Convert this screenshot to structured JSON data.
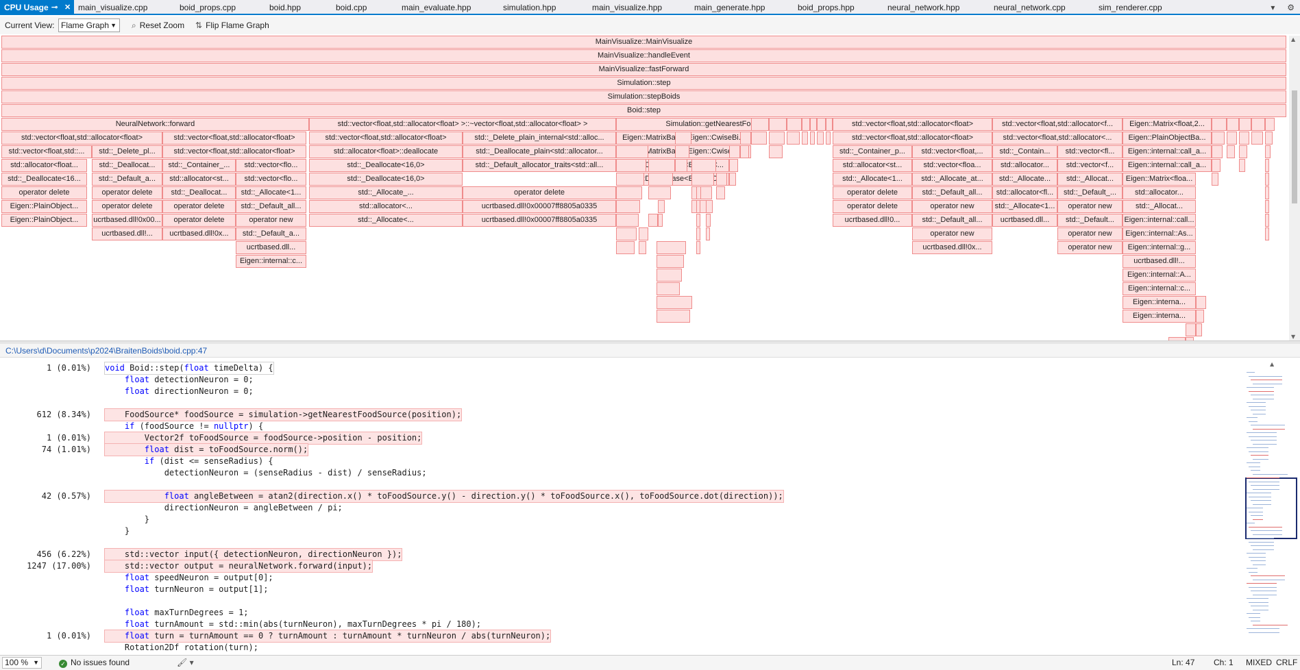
{
  "tabs": [
    {
      "label": "CPU Usage",
      "active": true
    },
    {
      "label": "main_visualize.cpp"
    },
    {
      "label": "boid_props.cpp"
    },
    {
      "label": "boid.hpp"
    },
    {
      "label": "boid.cpp"
    },
    {
      "label": "main_evaluate.hpp"
    },
    {
      "label": "simulation.hpp"
    },
    {
      "label": "main_visualize.hpp"
    },
    {
      "label": "main_generate.hpp"
    },
    {
      "label": "boid_props.hpp"
    },
    {
      "label": "neural_network.hpp"
    },
    {
      "label": "neural_network.cpp"
    },
    {
      "label": "sim_renderer.cpp"
    }
  ],
  "tab_icons": {
    "pin": "pin-icon",
    "close": "close-icon",
    "dropdown": "tab-list-dropdown-icon",
    "settings": "gear-icon"
  },
  "toolbar": {
    "view_label": "Current View:",
    "view_value": "Flame Graph",
    "reset_zoom": "Reset Zoom",
    "flip": "Flip Flame Graph"
  },
  "colors": {
    "frame_fill": "#fde0e0",
    "frame_border": "#ef8b8b",
    "accent": "#007acc",
    "hot_line": "#fde4e4"
  },
  "flame_frames": [
    {
      "label": "MainVisualize::MainVisualize"
    },
    {
      "label": "MainVisualize::handleEvent"
    },
    {
      "label": "MainVisualize::fastForward"
    },
    {
      "label": "Simulation::step"
    },
    {
      "label": "Simulation::stepBoids"
    },
    {
      "label": "Boid::step"
    },
    {
      "label": "NeuralNetwork::forward"
    },
    {
      "label": "std::vector<float,std::allocator<float> >::~vector<float,std::allocator<float> >"
    },
    {
      "label": "Simulation::getNearestFoodSource"
    },
    {
      "label": "std::vector<float,std::allocator<float>"
    },
    {
      "label": "std::vector<float,std::allocator<f..."
    },
    {
      "label": "Eigen::Matrix<float,2..."
    },
    {
      "label": "std::vector<float,std::allocator<float>"
    },
    {
      "label": "std::vector<float,std::allocator<float>"
    },
    {
      "label": "std::vector<float,std::allocator<float>"
    },
    {
      "label": "std::_Delete_plain_internal<std::alloc..."
    },
    {
      "label": "Eigen::MatrixBase<Eigen::CwiseBi..."
    },
    {
      "label": "std::vector<float,std::allocator<float>"
    },
    {
      "label": "std::vector<float,std::allocator<..."
    },
    {
      "label": "Eigen::PlainObjectBa..."
    },
    {
      "label": "std::vector<float,std::..."
    },
    {
      "label": "std::_Delete_pl..."
    },
    {
      "label": "std::vector<float,std::allocator<float>"
    },
    {
      "label": "std::allocator<float>::deallocate"
    },
    {
      "label": "std::_Deallocate_plain<std::allocator..."
    },
    {
      "label": "Eigen::MatrixBase<Eigen::CwiseBi..."
    },
    {
      "label": "std::_Container_p..."
    },
    {
      "label": "std::vector<float,..."
    },
    {
      "label": "std::_Contain..."
    },
    {
      "label": "std::vector<fl..."
    },
    {
      "label": "Eigen::internal::call_a..."
    },
    {
      "label": "std::allocator<float..."
    },
    {
      "label": "std::_Deallocat..."
    },
    {
      "label": "std::_Container_..."
    },
    {
      "label": "std::vector<flo..."
    },
    {
      "label": "std::_Deallocate<16,0>"
    },
    {
      "label": "std::_Default_allocator_traits<std::all..."
    },
    {
      "label": "Eigen::DenseBase<Eigen::C..."
    },
    {
      "label": "std::allocator<st..."
    },
    {
      "label": "std::vector<floa..."
    },
    {
      "label": "std::allocator..."
    },
    {
      "label": "std::vector<f..."
    },
    {
      "label": "Eigen::internal::call_a..."
    },
    {
      "label": "std::_Deallocate<16..."
    },
    {
      "label": "std::_Default_a..."
    },
    {
      "label": "std::allocator<st..."
    },
    {
      "label": "std::vector<flo..."
    },
    {
      "label": "operator delete"
    },
    {
      "label": "std::_Deallocate<16,0>"
    },
    {
      "label": "Eigen::DenseBase<Eigen::C..."
    },
    {
      "label": "std::_Allocate<1..."
    },
    {
      "label": "std::_Allocate_at..."
    },
    {
      "label": "std::_Allocate..."
    },
    {
      "label": "std::_Allocat..."
    },
    {
      "label": "Eigen::Matrix<floa..."
    },
    {
      "label": "operator delete"
    },
    {
      "label": "std::_Deallocat..."
    },
    {
      "label": "std::_Allocate<1..."
    },
    {
      "label": "std::_Allocate_..."
    },
    {
      "label": "operator delete"
    },
    {
      "label": "operator delete"
    },
    {
      "label": "std::_Default_all..."
    },
    {
      "label": "std::allocator<fl..."
    },
    {
      "label": "std::_Default_..."
    },
    {
      "label": "std::allocator..."
    },
    {
      "label": "Eigen::PlainObject..."
    },
    {
      "label": "operator delete"
    },
    {
      "label": "operator delete"
    },
    {
      "label": "std::_Default_all..."
    },
    {
      "label": "std::allocator<..."
    },
    {
      "label": "ucrtbased.dll!0x00007ff8805a0335"
    },
    {
      "label": "operator delete"
    },
    {
      "label": "operator new"
    },
    {
      "label": "std::_Allocate<1..."
    },
    {
      "label": "operator new"
    },
    {
      "label": "std::_Allocat..."
    },
    {
      "label": "Eigen::PlainObject..."
    },
    {
      "label": "ucrtbased.dll!0x00..."
    },
    {
      "label": "operator delete"
    },
    {
      "label": "operator new"
    },
    {
      "label": "std::_Allocate<..."
    },
    {
      "label": "ucrtbased.dll!0x00007ff8805a0335"
    },
    {
      "label": "ucrtbased.dll!0..."
    },
    {
      "label": "std::_Default_all..."
    },
    {
      "label": "ucrtbased.dll..."
    },
    {
      "label": "std::_Default..."
    },
    {
      "label": "Eigen::internal::call..."
    },
    {
      "label": "ucrtbased.dll!..."
    },
    {
      "label": "ucrtbased.dll!0x..."
    },
    {
      "label": "std::_Default_a..."
    },
    {
      "label": "operator new"
    },
    {
      "label": "operator new"
    },
    {
      "label": "Eigen::internal::As..."
    },
    {
      "label": "operator new"
    },
    {
      "label": "ucrtbased.dll!0x..."
    },
    {
      "label": "ucrtbased.dll..."
    },
    {
      "label": "Eigen::internal::g..."
    },
    {
      "label": "ucrtbased.dll!..."
    },
    {
      "label": "Eigen::internal::c..."
    },
    {
      "label": "Eigen::internal::A..."
    },
    {
      "label": "Eigen::internal::c..."
    },
    {
      "label": "Eigen::interna..."
    },
    {
      "label": "Eigen::interna..."
    }
  ],
  "path": "C:\\Users\\d\\Documents\\p2024\\BraitenBoids\\boid.cpp:47",
  "code_lines": [
    {
      "metric": "1 (0.01%)",
      "code": "void Boid::step(float timeDelta) {"
    },
    {
      "metric": "",
      "code": "    float detectionNeuron = 0;"
    },
    {
      "metric": "",
      "code": "    float directionNeuron = 0;"
    },
    {
      "metric": "",
      "code": ""
    },
    {
      "metric": "612 (8.34%)",
      "code": "    FoodSource* foodSource = simulation->getNearestFoodSource(position);"
    },
    {
      "metric": "",
      "code": "    if (foodSource != nullptr) {"
    },
    {
      "metric": "1 (0.01%)",
      "code": "        Vector2f toFoodSource = foodSource->position - position;"
    },
    {
      "metric": "74 (1.01%)",
      "code": "        float dist = toFoodSource.norm();"
    },
    {
      "metric": "",
      "code": "        if (dist <= senseRadius) {"
    },
    {
      "metric": "",
      "code": "            detectionNeuron = (senseRadius - dist) / senseRadius;"
    },
    {
      "metric": "",
      "code": ""
    },
    {
      "metric": "42 (0.57%)",
      "code": "            float angleBetween = atan2(direction.x() * toFoodSource.y() - direction.y() * toFoodSource.x(), toFoodSource.dot(direction));"
    },
    {
      "metric": "",
      "code": "            directionNeuron = angleBetween / pi;"
    },
    {
      "metric": "",
      "code": "        }"
    },
    {
      "metric": "",
      "code": "    }"
    },
    {
      "metric": "",
      "code": ""
    },
    {
      "metric": "456 (6.22%)",
      "code": "    std::vector input({ detectionNeuron, directionNeuron });"
    },
    {
      "metric": "1247 (17.00%)",
      "code": "    std::vector output = neuralNetwork.forward(input);"
    },
    {
      "metric": "",
      "code": "    float speedNeuron = output[0];"
    },
    {
      "metric": "",
      "code": "    float turnNeuron = output[1];"
    },
    {
      "metric": "",
      "code": ""
    },
    {
      "metric": "",
      "code": "    float maxTurnDegrees = 1;"
    },
    {
      "metric": "",
      "code": "    float turnAmount = std::min(abs(turnNeuron), maxTurnDegrees * pi / 180);"
    },
    {
      "metric": "1 (0.01%)",
      "code": "    float turn = turnAmount == 0 ? turnAmount : turnAmount * turnNeuron / abs(turnNeuron);"
    },
    {
      "metric": "",
      "code": "    Rotation2Df rotation(turn);"
    }
  ],
  "status": {
    "zoom": "100 %",
    "issues": "No issues found",
    "ln": "Ln: 47",
    "ch": "Ch: 1",
    "mixed": "MIXED",
    "eol": "CRLF"
  }
}
